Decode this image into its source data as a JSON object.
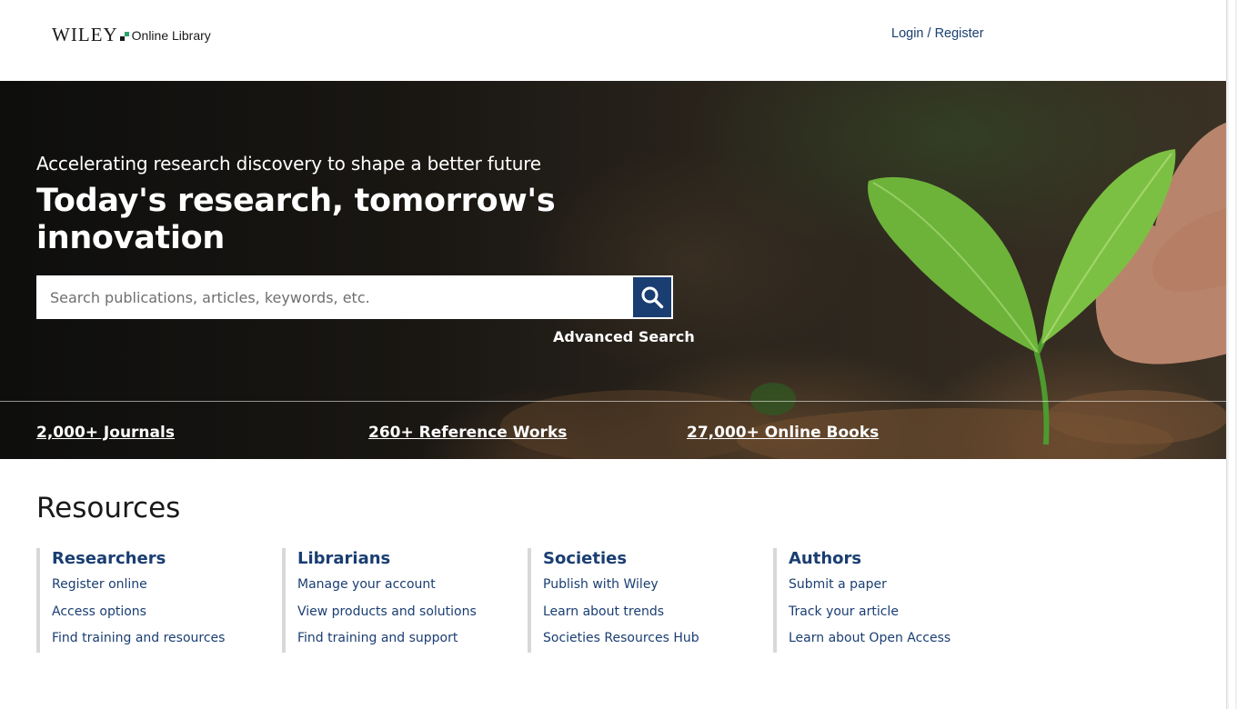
{
  "header": {
    "logo_wiley": "WILEY",
    "logo_suffix": "Online Library",
    "login_label": "Login / Register"
  },
  "hero": {
    "subtitle": "Accelerating research discovery to shape a better future",
    "title": "Today's research, tomorrow's innovation",
    "search": {
      "placeholder": "Search publications, articles, keywords, etc.",
      "value": "",
      "button_icon": "search-icon"
    },
    "advanced_search_label": "Advanced Search",
    "stats": [
      "2,000+ Journals",
      "260+ Reference Works",
      "27,000+ Online Books"
    ]
  },
  "resources": {
    "title": "Resources",
    "columns": [
      {
        "heading": "Researchers",
        "links": [
          "Register online",
          "Access options",
          "Find training and resources"
        ]
      },
      {
        "heading": "Librarians",
        "links": [
          "Manage your account",
          "View products and solutions",
          "Find training and support"
        ]
      },
      {
        "heading": "Societies",
        "links": [
          "Publish with Wiley",
          "Learn about trends",
          "Societies Resources Hub"
        ]
      },
      {
        "heading": "Authors",
        "links": [
          "Submit a paper",
          "Track your article",
          "Learn about Open Access"
        ]
      }
    ]
  },
  "colors": {
    "brand_navy": "#1a3e72",
    "brand_green": "#2ca36b",
    "divider_gray": "#d8d8d8"
  }
}
